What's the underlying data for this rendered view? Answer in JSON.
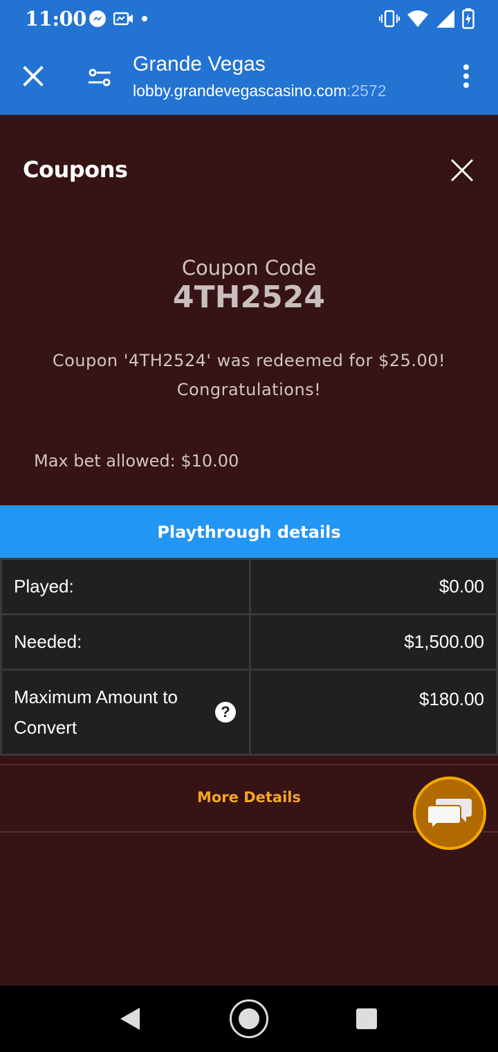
{
  "status_bar": {
    "time": "11:00",
    "left_icons": [
      "messenger-icon",
      "video-message-icon",
      "dot-icon"
    ],
    "right_icons": [
      "vibrate-icon",
      "wifi-icon",
      "signal-icon",
      "battery-charging-icon"
    ]
  },
  "browser": {
    "title": "Grande Vegas",
    "url_host": "lobby.grandevegascasino.com",
    "url_port": ":2572"
  },
  "coupons": {
    "title": "Coupons",
    "code_label": "Coupon Code",
    "code": "4TH2524",
    "message_line1": "Coupon '4TH2524' was redeemed for $25.00!",
    "message_line2": "Congratulations!",
    "max_bet": "Max bet allowed: $10.00"
  },
  "playthrough": {
    "header": "Playthrough details",
    "rows": [
      {
        "label": "Played:",
        "value": "$0.00"
      },
      {
        "label": "Needed:",
        "value": "$1,500.00"
      },
      {
        "label": "Maximum Amount to Convert",
        "value": "$180.00"
      }
    ],
    "help_symbol": "?"
  },
  "more_details": "More Details",
  "colors": {
    "browser_blue": "#2273d2",
    "panel_bg": "#361315",
    "header_blue": "#2296f3",
    "accent_orange": "#f5a623"
  }
}
